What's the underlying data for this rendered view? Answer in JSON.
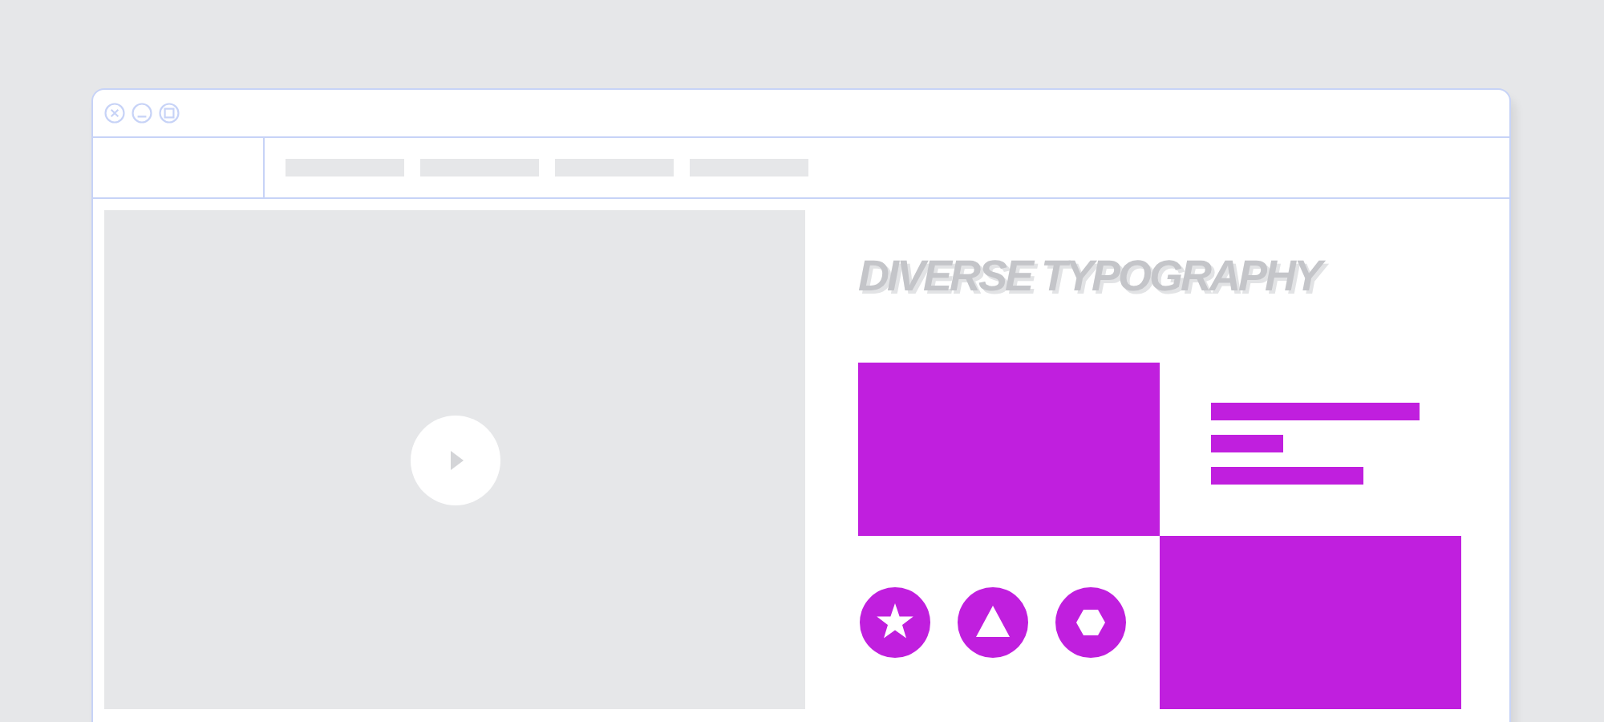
{
  "heading": "DIVERSE TYPOGRAPHY",
  "icons": [
    {
      "kind": "star"
    },
    {
      "kind": "triangle"
    },
    {
      "kind": "hexagon"
    }
  ]
}
